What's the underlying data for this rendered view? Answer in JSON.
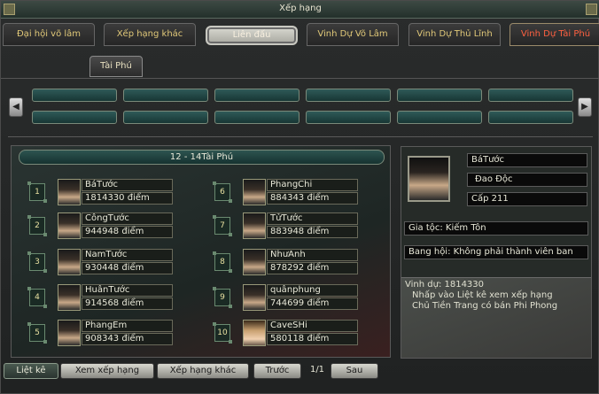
{
  "window": {
    "title": "Xếp hạng"
  },
  "tabs": [
    "Đại hội võ lâm",
    "Xếp hạng khác",
    "Liên đấu",
    "Vinh Dự Võ Lâm",
    "Vinh Dự Thủ Lĩnh",
    "Vinh Dự Tài Phú"
  ],
  "sub_tab": "Tài Phú",
  "ranking": {
    "header": "12 - 14Tài Phú",
    "entries": [
      {
        "rank": "1",
        "name": "BáTước",
        "score": "1814330 điểm"
      },
      {
        "rank": "2",
        "name": "CôngTước",
        "score": "944948 điểm"
      },
      {
        "rank": "3",
        "name": "NamTước",
        "score": "930448 điểm"
      },
      {
        "rank": "4",
        "name": "HuânTước",
        "score": "914568 điểm"
      },
      {
        "rank": "5",
        "name": "PhangEm",
        "score": "908343 điểm"
      },
      {
        "rank": "6",
        "name": "PhangChi",
        "score": "884343 điểm"
      },
      {
        "rank": "7",
        "name": "TửTước",
        "score": "883948 điểm"
      },
      {
        "rank": "8",
        "name": "NhưAnh",
        "score": "878292 điểm"
      },
      {
        "rank": "9",
        "name": "quânphung",
        "score": "744699 điểm"
      },
      {
        "rank": "10",
        "name": "CaveSHi",
        "score": "580118 điểm"
      }
    ]
  },
  "info": {
    "name": "BáTước",
    "faction": "Đao Độc",
    "level": "Cấp 211",
    "clan": "Gia tộc: Kiếm Tôn",
    "guild": "Bang hội: Không phải thành viên ban",
    "honor": "Vinh dự: 1814330",
    "note1": "Nhấp vào Liệt kê xem  xếp hạng",
    "note2": "Chủ Tiền Trang có bán Phi Phong"
  },
  "bottom": {
    "list": "Liệt kê",
    "view": "Xem xếp hạng",
    "other": "Xếp hạng khác",
    "prev": "Trước",
    "page": "1/1",
    "next": "Sau"
  }
}
